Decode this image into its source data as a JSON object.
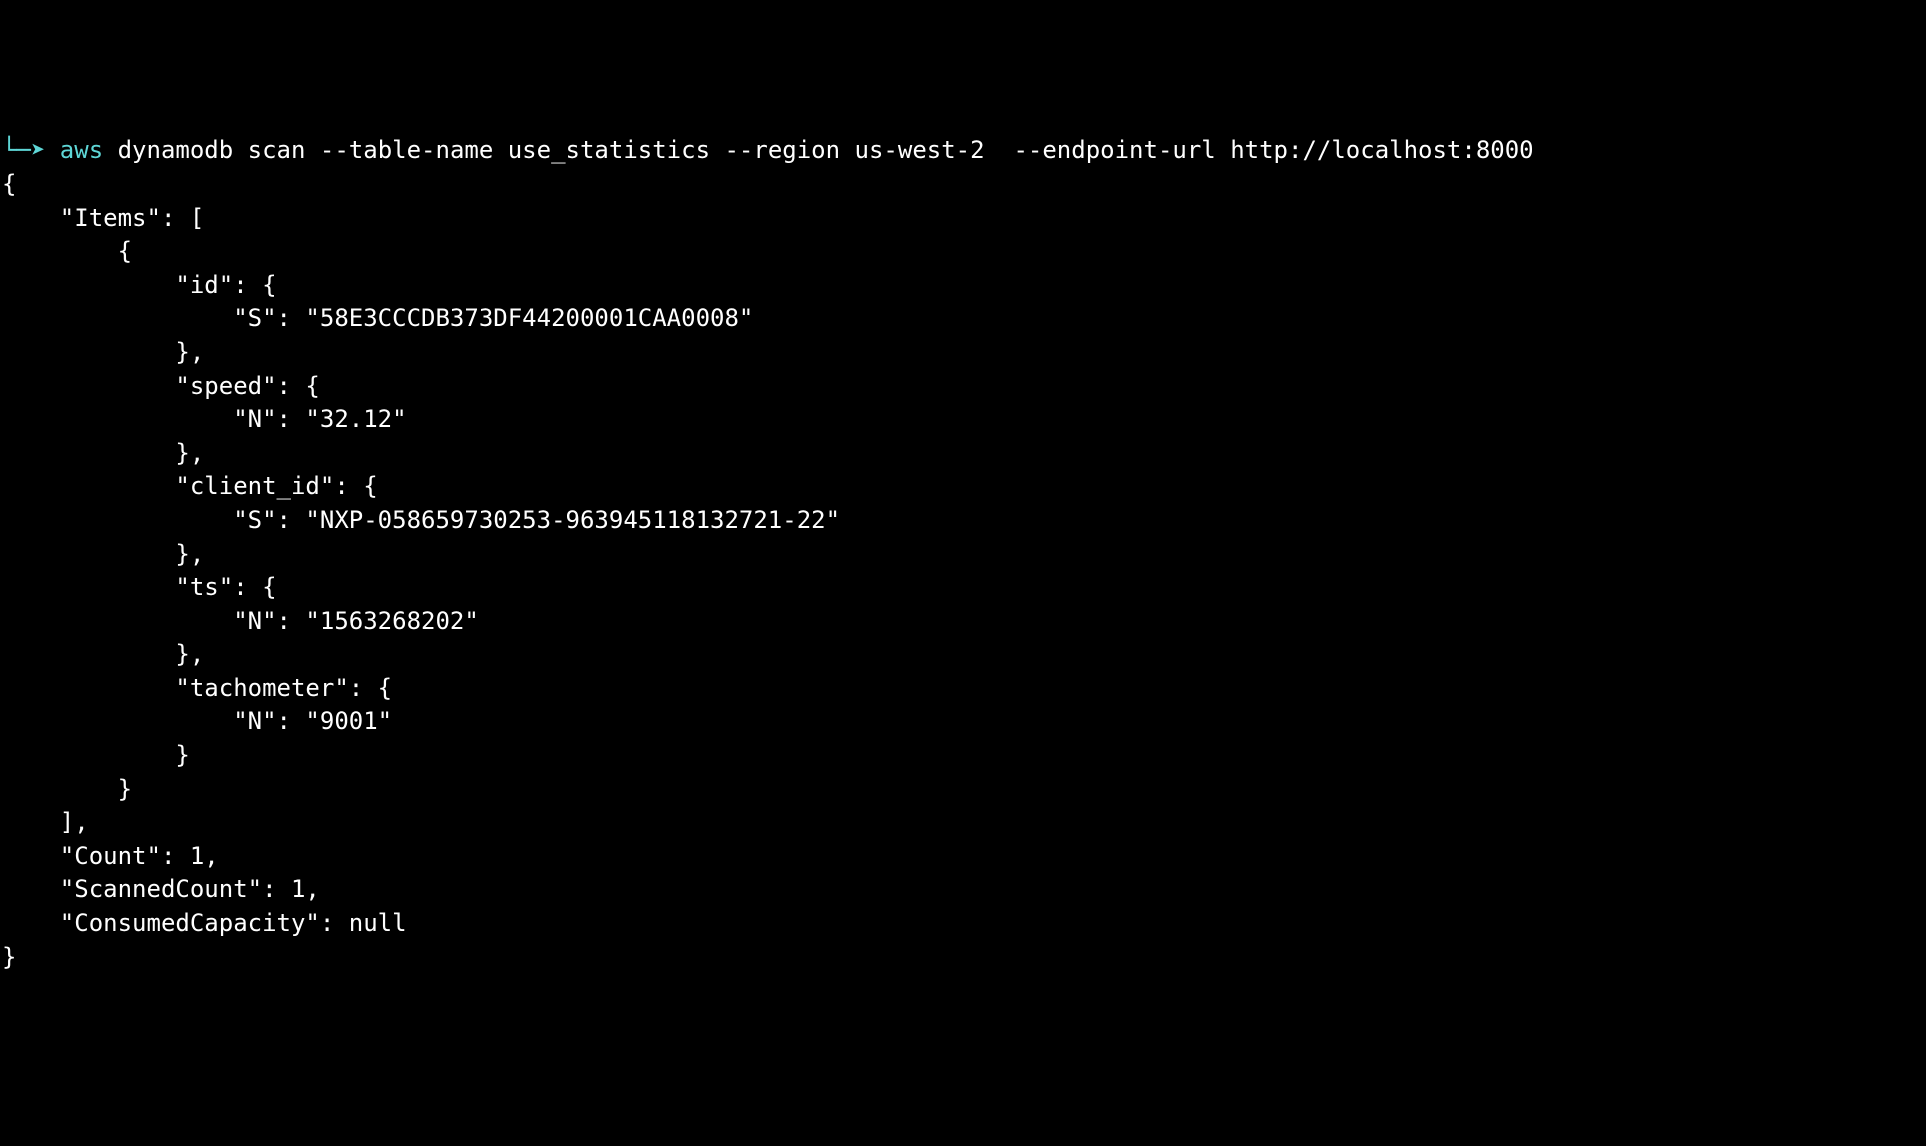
{
  "prompt": {
    "circle": "●",
    "box_arrow": "└─➤ ",
    "aws": "aws",
    "rest": " dynamodb scan --table-name use_statistics --region us-west-2  --endpoint-url http://localhost:8000"
  },
  "output": {
    "line01": "{",
    "line02": "    \"Items\": [",
    "line03": "        {",
    "line04": "            \"id\": {",
    "line05": "                \"S\": \"58E3CCCDB373DF44200001CAA0008\"",
    "line06": "            },",
    "line07": "            \"speed\": {",
    "line08": "                \"N\": \"32.12\"",
    "line09": "            },",
    "line10": "            \"client_id\": {",
    "line11": "                \"S\": \"NXP-058659730253-963945118132721-22\"",
    "line12": "            },",
    "line13": "            \"ts\": {",
    "line14": "                \"N\": \"1563268202\"",
    "line15": "            },",
    "line16": "            \"tachometer\": {",
    "line17": "                \"N\": \"9001\"",
    "line18": "            }",
    "line19": "        }",
    "line20": "    ],",
    "line21": "    \"Count\": 1,",
    "line22": "    \"ScannedCount\": 1,",
    "line23": "    \"ConsumedCapacity\": null",
    "line24": "}"
  }
}
